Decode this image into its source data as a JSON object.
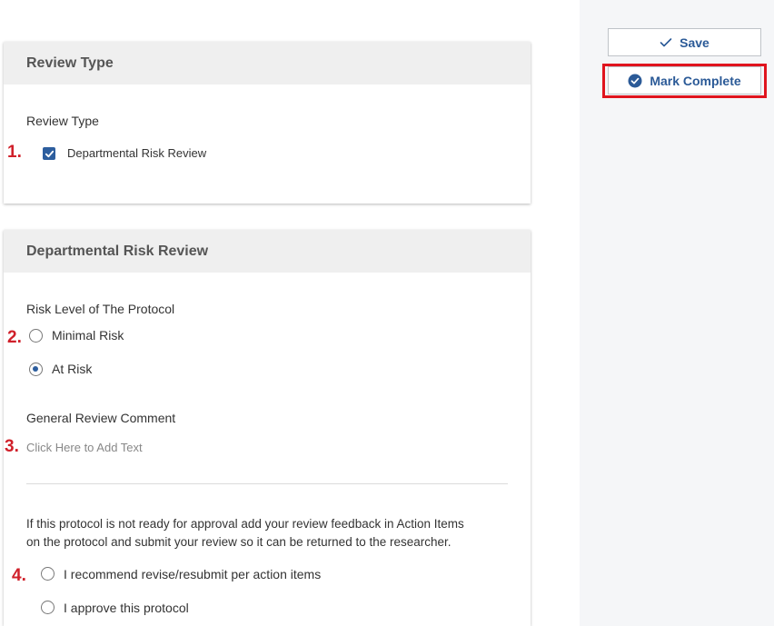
{
  "sections": {
    "review_type": {
      "header": "Review Type",
      "field_label": "Review Type",
      "checkbox_label": "Departmental Risk Review",
      "checkbox_checked": true
    },
    "departmental_risk_review": {
      "header": "Departmental Risk Review",
      "risk_level_label": "Risk Level of The Protocol",
      "risk_options": [
        {
          "label": "Minimal Risk",
          "selected": false
        },
        {
          "label": "At Risk",
          "selected": true
        }
      ],
      "comment_label": "General Review Comment",
      "comment_placeholder": "Click Here to Add Text",
      "instructions_line1": "If this protocol is not ready for approval add your review feedback in Action Items",
      "instructions_line2": "on the protocol and submit your review so it can be returned to the researcher.",
      "recommend_options": [
        {
          "label": "I recommend revise/resubmit per action items",
          "selected": false
        },
        {
          "label": "I approve this protocol",
          "selected": false
        }
      ]
    }
  },
  "annotations": {
    "marker_1": "1.",
    "marker_2": "2.",
    "marker_3": "3.",
    "marker_4": "4."
  },
  "actions": {
    "save_label": "Save",
    "mark_complete_label": "Mark Complete"
  },
  "colors": {
    "accent": "#2d5e9e",
    "button_text": "#2b5a97",
    "annotation_red": "#d0202a",
    "highlight_border": "#e0141e"
  },
  "icons": {
    "save": "check-icon",
    "mark_complete": "check-circle-icon"
  }
}
